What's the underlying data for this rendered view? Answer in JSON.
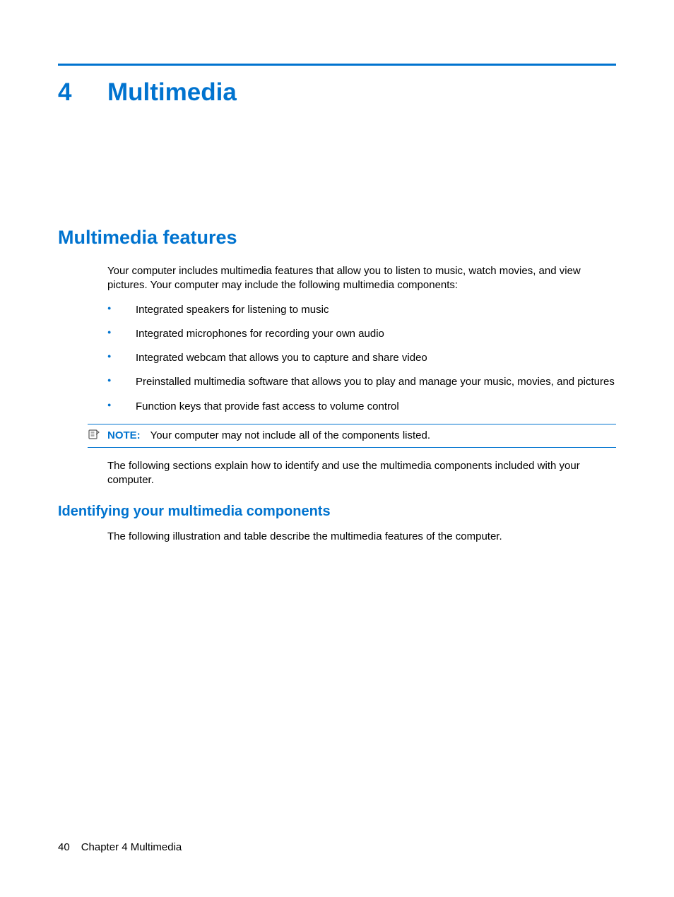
{
  "chapter": {
    "number": "4",
    "title": "Multimedia"
  },
  "section": {
    "heading": "Multimedia features",
    "intro": "Your computer includes multimedia features that allow you to listen to music, watch movies, and view pictures. Your computer may include the following multimedia components:",
    "bullets": [
      "Integrated speakers for listening to music",
      "Integrated microphones for recording your own audio",
      "Integrated webcam that allows you to capture and share video",
      "Preinstalled multimedia software that allows you to play and manage your music, movies, and pictures",
      "Function keys that provide fast access to volume control"
    ],
    "note": {
      "label": "NOTE:",
      "text": "Your computer may not include all of the components listed."
    },
    "after_note": "The following sections explain how to identify and use the multimedia components included with your computer."
  },
  "subsection": {
    "heading": "Identifying your multimedia components",
    "text": "The following illustration and table describe the multimedia features of the computer."
  },
  "footer": {
    "page_number": "40",
    "label": "Chapter 4   Multimedia"
  }
}
